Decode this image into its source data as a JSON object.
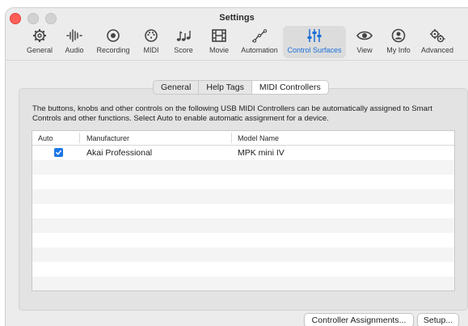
{
  "window": {
    "title": "Settings"
  },
  "toolbar": {
    "items": [
      {
        "label": "General",
        "icon": "gear-icon"
      },
      {
        "label": "Audio",
        "icon": "waveform-icon"
      },
      {
        "label": "Recording",
        "icon": "record-icon"
      },
      {
        "label": "MIDI",
        "icon": "midi-port-icon"
      },
      {
        "label": "Score",
        "icon": "music-notes-icon"
      },
      {
        "label": "Movie",
        "icon": "film-icon"
      },
      {
        "label": "Automation",
        "icon": "automation-curve-icon"
      },
      {
        "label": "Control Surfaces",
        "icon": "faders-icon",
        "active": true
      },
      {
        "label": "View",
        "icon": "eye-icon"
      },
      {
        "label": "My Info",
        "icon": "person-icon"
      },
      {
        "label": "Advanced",
        "icon": "gears-icon"
      }
    ]
  },
  "tabs": [
    {
      "label": "General"
    },
    {
      "label": "Help Tags"
    },
    {
      "label": "MIDI Controllers",
      "selected": true
    }
  ],
  "description": "The buttons, knobs and other controls on the following USB MIDI Controllers can be automatically assigned to Smart Controls and other functions. Select Auto to enable automatic assignment for a device.",
  "table": {
    "columns": [
      "Auto",
      "Manufacturer",
      "Model Name"
    ],
    "rows": [
      {
        "auto": true,
        "manufacturer": "Akai Professional",
        "model": "MPK mini IV"
      }
    ]
  },
  "buttons": {
    "controller_assignments": "Controller Assignments...",
    "setup": "Setup..."
  },
  "colors": {
    "accent": "#1d77e6",
    "close": "#ff5f57"
  }
}
